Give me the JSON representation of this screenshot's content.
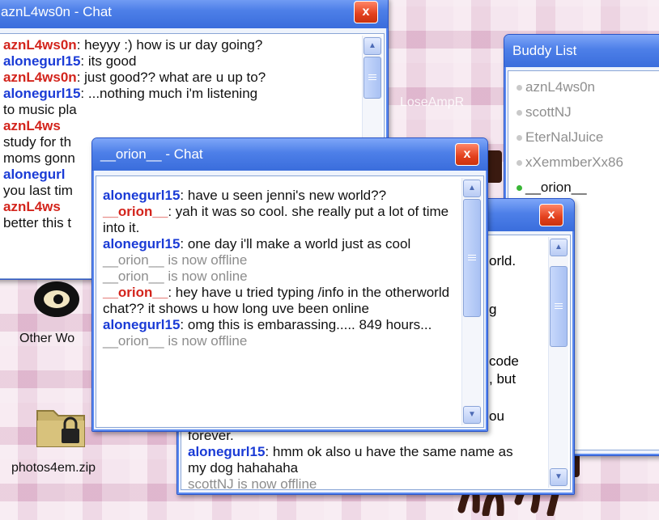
{
  "background_watermark": "LoseAmpR",
  "chat_aznl": {
    "title": "aznL4ws0n - Chat",
    "close_label": "x",
    "messages": [
      {
        "name": "aznL4ws0n",
        "color": "red",
        "text": ": heyyy :) how is ur day going?"
      },
      {
        "name": "alonegurl15",
        "color": "blue",
        "text": ": its good"
      },
      {
        "name": "aznL4ws0n",
        "color": "red",
        "text": ": just good?? what are u up to?"
      },
      {
        "name": "alonegurl15",
        "color": "blue",
        "text": ": ...nothing much i'm listening"
      },
      {
        "name": "",
        "color": "",
        "text": "to music pla"
      },
      {
        "name": "aznL4ws",
        "color": "red",
        "text": ""
      },
      {
        "name": "",
        "color": "",
        "text": "study for th"
      },
      {
        "name": "",
        "color": "",
        "text": "moms gonn"
      },
      {
        "name": "alonegurl",
        "color": "blue",
        "text": ""
      },
      {
        "name": "",
        "color": "",
        "text": "you last tim"
      },
      {
        "name": "aznL4ws",
        "color": "red",
        "text": ""
      },
      {
        "name": "",
        "color": "",
        "text": "better this t"
      }
    ]
  },
  "buddy_list": {
    "title": "Buddy List",
    "buddies": [
      {
        "name": "aznL4ws0n",
        "online": false
      },
      {
        "name": "scottNJ",
        "online": false
      },
      {
        "name": "EterNalJuice",
        "online": false
      },
      {
        "name": "xXemmberXx86",
        "online": false
      },
      {
        "name": "__orion__",
        "online": true
      }
    ]
  },
  "chat_third": {
    "close_label": "x",
    "visible_fragments": [
      "orld.",
      "g",
      "code",
      ", but",
      "ou"
    ],
    "messages_bottom": [
      {
        "name": "",
        "color": "",
        "text": "forever."
      },
      {
        "name": "alonegurl15",
        "color": "blue",
        "text": ": hmm ok also u have the same name as my dog hahahaha"
      },
      {
        "name": "",
        "color": "sys",
        "text": "scottNJ is now offline"
      }
    ]
  },
  "chat_orion": {
    "title": "__orion__ - Chat",
    "close_label": "x",
    "messages": [
      {
        "name": "alonegurl15",
        "color": "blue",
        "text": ": have u seen jenni's new world??"
      },
      {
        "name": "__orion__",
        "color": "red",
        "text": ": yah it was so cool. she really put a lot of time into it."
      },
      {
        "name": "alonegurl15",
        "color": "blue",
        "text": ": one day i'll make a world just as cool"
      },
      {
        "name": "",
        "color": "sys",
        "text": "__orion__ is now offline"
      },
      {
        "name": "",
        "color": "sys",
        "text": "__orion__ is now online"
      },
      {
        "name": "__orion__",
        "color": "red",
        "text": ": hey have u tried typing /info in the otherworld chat?? it shows u how long uve been online"
      },
      {
        "name": "alonegurl15",
        "color": "blue",
        "text": ": omg this is embarassing..... 849 hours..."
      },
      {
        "name": "",
        "color": "sys",
        "text": "__orion__ is now offline"
      }
    ]
  },
  "desktop_icons": [
    {
      "label": "Other Wo"
    },
    {
      "label": "photos4em.zip"
    }
  ],
  "scroll_up_icon": "▲",
  "scroll_down_icon": "▼"
}
